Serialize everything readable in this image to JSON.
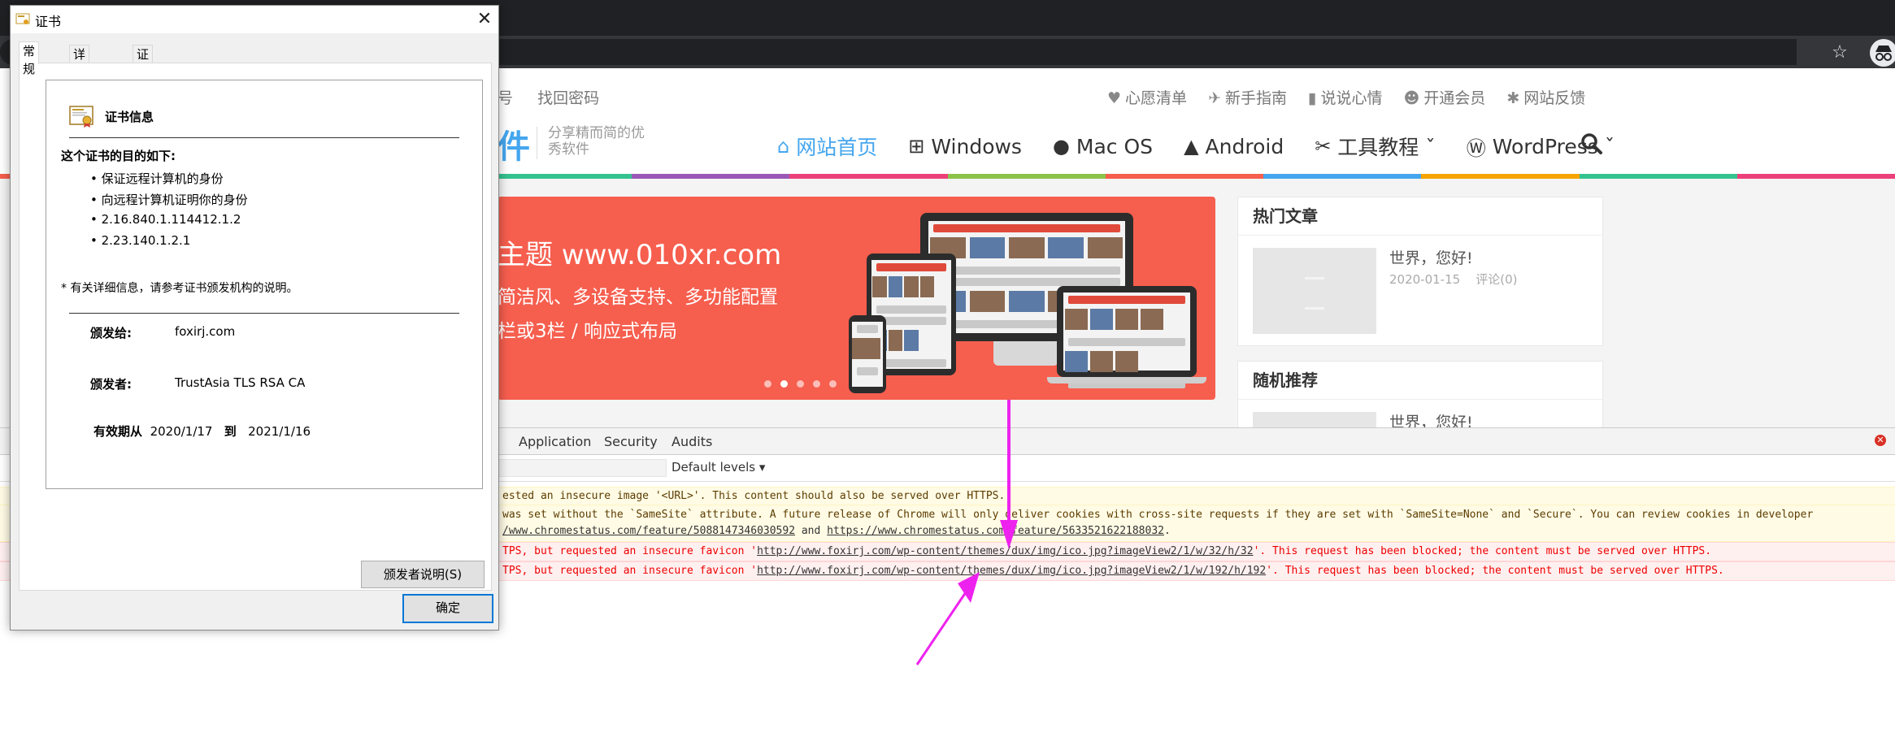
{
  "dialog": {
    "title": "证书",
    "tabs": [
      "常规",
      "详细信息",
      "证书路径"
    ],
    "cert_info_header": "证书信息",
    "purpose_heading": "这个证书的目的如下:",
    "purposes": [
      "• 保证远程计算机的身份",
      "• 向远程计算机证明你的身份",
      "• 2.16.840.1.114412.1.2",
      "• 2.23.140.1.2.1"
    ],
    "note": "* 有关详细信息，请参考证书颁发机构的说明。",
    "issued_to_label": "颁发给:",
    "issued_to": "foxirj.com",
    "issued_by_label": "颁发者:",
    "issued_by": "TrustAsia TLS RSA CA",
    "valid_from_label": "有效期从",
    "valid_from": "2020/1/17",
    "valid_to_label": "到",
    "valid_to": "2021/1/16",
    "issuer_statement_btn": "颁发者说明(S)",
    "ok_btn": "确定"
  },
  "site": {
    "toplinks_left": [
      "号",
      "找回密码"
    ],
    "toplinks_right": [
      {
        "icon": "heart-icon",
        "glyph": "♥",
        "label": "心愿清单"
      },
      {
        "icon": "plane-icon",
        "glyph": "✈",
        "label": "新手指南"
      },
      {
        "icon": "bookmark-icon",
        "glyph": "▮",
        "label": "说说心情"
      },
      {
        "icon": "user-icon",
        "glyph": "☻",
        "label": "开通会员"
      },
      {
        "icon": "bug-icon",
        "glyph": "✱",
        "label": "网站反馈"
      }
    ],
    "logo_char": "件",
    "slogan": "分享精而简的优秀软件",
    "nav": [
      {
        "icon": "home-icon",
        "glyph": "⌂",
        "label": "网站首页"
      },
      {
        "icon": "windows-icon",
        "glyph": "⊞",
        "label": "Windows"
      },
      {
        "icon": "apple-icon",
        "glyph": "●",
        "label": "Mac OS"
      },
      {
        "icon": "android-icon",
        "glyph": "▲",
        "label": "Android"
      },
      {
        "icon": "tools-icon",
        "glyph": "✂",
        "label": "工具教程 ˇ"
      },
      {
        "icon": "wordpress-icon",
        "glyph": "Ⓦ",
        "label": "WordPress ˇ"
      }
    ],
    "banner": {
      "line1": "主题 www.010xr.com",
      "line2": "简洁风、多设备支持、多功能配置",
      "line3": "栏或3栏 / 响应式布局"
    },
    "hot_widget": {
      "title": "热门文章",
      "post_title": "世界，您好!",
      "post_date": "2020-01-15",
      "post_comments": "评论(0)"
    },
    "random_widget": {
      "title": "随机推荐",
      "post_title": "世界，您好!"
    },
    "colors": {
      "accent": "#45a6ee",
      "banner": "#f65e4e"
    },
    "rainbow": [
      "#f65e4e",
      "#45a6ee",
      "#f7a400",
      "#34c38f",
      "#9b59b6",
      "#ec407a",
      "#8bc34a",
      "#f65e4e",
      "#45a6ee",
      "#f7a400",
      "#34c38f",
      "#ec407a"
    ]
  },
  "devtools": {
    "tabs": [
      "Application",
      "Security",
      "Audits"
    ],
    "levels": "Default levels ▾",
    "messages": [
      {
        "type": "warn",
        "text": "ested an insecure image '<URL>'. This content should also be served over HTTPS."
      },
      {
        "type": "warn",
        "pre": "was set without the `SameSite` attribute. A future release of Chrome will only deliver cookies with cross-site requests if they are set with `SameSite=None` and `Secure`. You can review cookies in developer",
        "line2_pre": "/www.chromestatus.com/feature/5088147346030592",
        "line2_mid": " and ",
        "line2_link": "https://www.chromestatus.com/feature/5633521622188032",
        "line2_post": "."
      },
      {
        "type": "err",
        "pre": "TPS, but requested an insecure favicon '",
        "link": "http://www.foxirj.com/wp-content/themes/dux/img/ico.jpg?imageView2/1/w/32/h/32",
        "post": "'. This request has been blocked; the content must be served over HTTPS."
      },
      {
        "type": "err",
        "pre": "TPS, but requested an insecure favicon '",
        "link": "http://www.foxirj.com/wp-content/themes/dux/img/ico.jpg?imageView2/1/w/192/h/192",
        "post": "'. This request has been blocked; the content must be served over HTTPS."
      }
    ]
  }
}
